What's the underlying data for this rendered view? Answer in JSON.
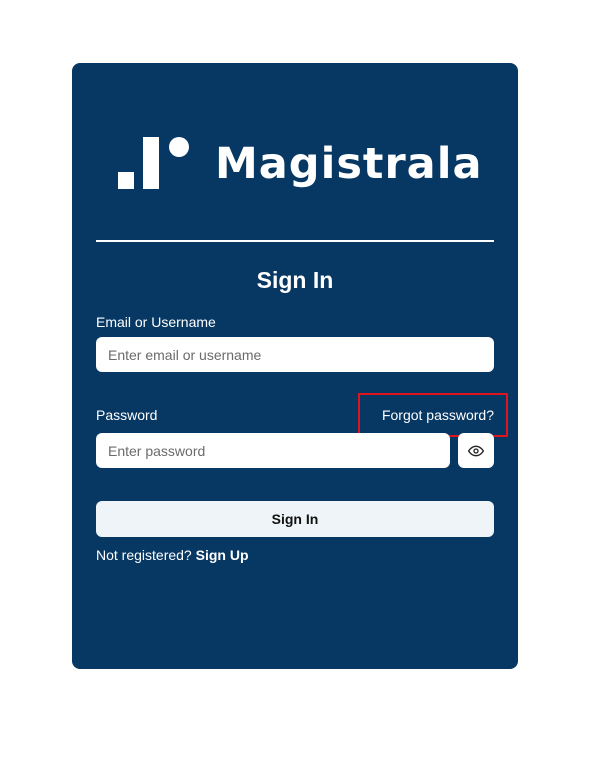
{
  "brand": {
    "name": "Magistrala",
    "logo_icon": "magistrala-logo-icon"
  },
  "form": {
    "title": "Sign In",
    "email": {
      "label": "Email or Username",
      "placeholder": "Enter email or username",
      "value": ""
    },
    "password": {
      "label": "Password",
      "placeholder": "Enter password",
      "value": "",
      "toggle_icon": "eye-icon"
    },
    "forgot_password_label": "Forgot password?",
    "submit_label": "Sign In",
    "register_prompt": "Not registered?",
    "register_link_label": "Sign Up"
  },
  "colors": {
    "card_background": "#073763",
    "button_background": "#eef4f8",
    "highlight": "#e0141e"
  }
}
